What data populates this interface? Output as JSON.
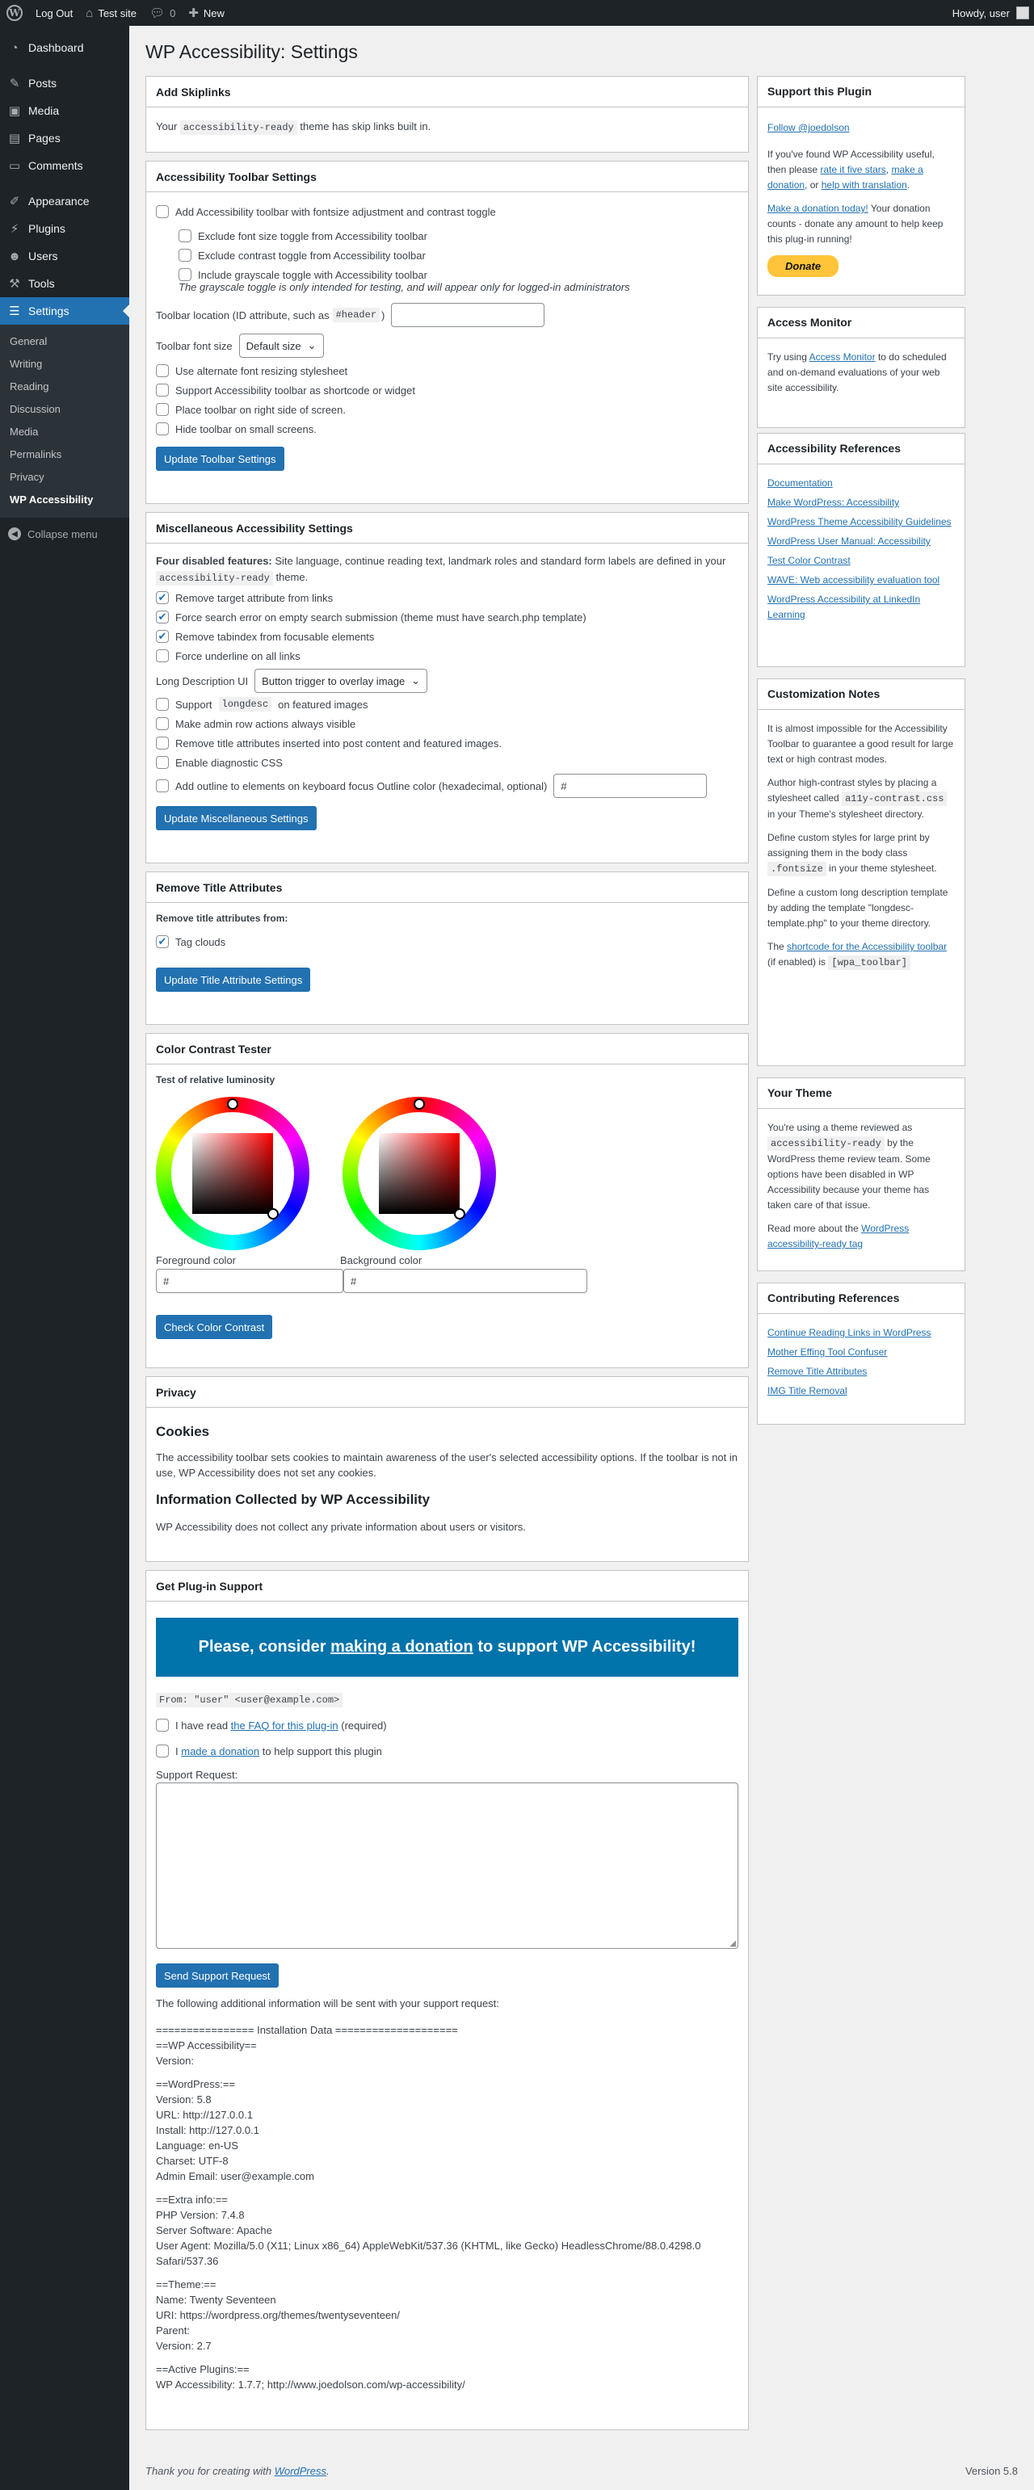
{
  "adminbar": {
    "logout": "Log Out",
    "site": "Test site",
    "comments_count": "0",
    "new": "New",
    "howdy": "Howdy, user"
  },
  "sidebar": {
    "items": [
      {
        "label": "Dashboard",
        "icon": "dashboard-icon"
      },
      {
        "label": "Posts",
        "icon": "pin-icon"
      },
      {
        "label": "Media",
        "icon": "media-icon"
      },
      {
        "label": "Pages",
        "icon": "page-icon"
      },
      {
        "label": "Comments",
        "icon": "comment-icon"
      },
      {
        "label": "Appearance",
        "icon": "brush-icon"
      },
      {
        "label": "Plugins",
        "icon": "plugin-icon"
      },
      {
        "label": "Users",
        "icon": "user-icon"
      },
      {
        "label": "Tools",
        "icon": "wrench-icon"
      },
      {
        "label": "Settings",
        "icon": "settings-icon"
      }
    ],
    "submenu": [
      "General",
      "Writing",
      "Reading",
      "Discussion",
      "Media",
      "Permalinks",
      "Privacy",
      "WP Accessibility"
    ],
    "collapse": "Collapse menu"
  },
  "page": {
    "title": "WP Accessibility: Settings"
  },
  "skiplinks": {
    "title": "Add Skiplinks",
    "text_pre": "Your",
    "code": "accessibility-ready",
    "text_post": "theme has skip links built in."
  },
  "toolbar": {
    "title": "Accessibility Toolbar Settings",
    "add": "Add Accessibility toolbar with fontsize adjustment and contrast toggle",
    "ex_font": "Exclude font size toggle from Accessibility toolbar",
    "ex_contrast": "Exclude contrast toggle from Accessibility toolbar",
    "grayscale": "Include grayscale toggle with Accessibility toolbar",
    "grayscale_note": "The grayscale toggle is only intended for testing, and will appear only for logged-in administrators",
    "location_pre": "Toolbar location (ID attribute, such as",
    "location_code": "#header",
    "location_post": ")",
    "font_label": "Toolbar font size",
    "font_value": "Default size",
    "alt_font": "Use alternate font resizing stylesheet",
    "shortcode": "Support Accessibility toolbar as shortcode or widget",
    "right": "Place toolbar on right side of screen.",
    "hide": "Hide toolbar on small screens.",
    "button": "Update Toolbar Settings"
  },
  "misc": {
    "title": "Miscellaneous Accessibility Settings",
    "disabled_bold": "Four disabled features:",
    "disabled_text": "Site language, continue reading text, landmark roles and standard form labels are defined in your",
    "disabled_code": "accessibility-ready",
    "disabled_post": "theme.",
    "target": "Remove target attribute from links",
    "search": "Force search error on empty search submission (theme must have search.php template)",
    "tabindex": "Remove tabindex from focusable elements",
    "underline": "Force underline on all links",
    "longdesc_label": "Long Description UI",
    "longdesc_value": "Button trigger to overlay image",
    "support_pre": "Support",
    "support_code": "longdesc",
    "support_post": "on featured images",
    "admin_rows": "Make admin row actions always visible",
    "title_attr": "Remove title attributes inserted into post content and featured images.",
    "diagnostic": "Enable diagnostic CSS",
    "outline": "Add outline to elements on keyboard focus Outline color (hexadecimal, optional)",
    "outline_value": "#",
    "button": "Update Miscellaneous Settings"
  },
  "titleattr": {
    "title": "Remove Title Attributes",
    "from": "Remove title attributes from:",
    "tag": "Tag clouds",
    "button": "Update Title Attribute Settings"
  },
  "contrast": {
    "title": "Color Contrast Tester",
    "sub": "Test of relative luminosity",
    "fg_label": "Foreground color",
    "bg_label": "Background color",
    "fg_value": "#",
    "bg_value": "#",
    "button": "Check Color Contrast"
  },
  "privacy": {
    "title": "Privacy",
    "cookies_h": "Cookies",
    "cookies_text": "The accessibility toolbar sets cookies to maintain awareness of the user's selected accessibility options. If the toolbar is not in use, WP Accessibility does not set any cookies.",
    "info_h": "Information Collected by WP Accessibility",
    "info_text": "WP Accessibility does not collect any private information about users or visitors."
  },
  "support": {
    "title": "Get Plug-in Support",
    "banner_pre": "Please, consider",
    "banner_link": "making a donation",
    "banner_post": "to support WP Accessibility!",
    "from": "From: \"user\" <user@example.com>",
    "faq_pre": "I have read",
    "faq_link": "the FAQ for this plug-in",
    "faq_post": "(required)",
    "don_pre": "I",
    "don_link": "made a donation",
    "don_post": "to help support this plugin",
    "request_label": "Support Request:",
    "button": "Send Support Request",
    "following": "The following additional information will be sent with your support request:",
    "install": "================ Installation Data ====================\n==WP Accessibility==\nVersion:",
    "wp": "==WordPress:==\nVersion: 5.8\nURL: http://127.0.0.1\nInstall: http://127.0.0.1\nLanguage: en-US\nCharset: UTF-8\nAdmin Email: user@example.com",
    "extra": "==Extra info:==\nPHP Version: 7.4.8\nServer Software: Apache\nUser Agent: Mozilla/5.0 (X11; Linux x86_64) AppleWebKit/537.36 (KHTML, like Gecko) HeadlessChrome/88.0.4298.0 Safari/537.36",
    "theme": "==Theme:==\nName: Twenty Seventeen\nURI: https://wordpress.org/themes/twentyseventeen/\nParent:\nVersion: 2.7",
    "plugins": "==Active Plugins:==\nWP Accessibility: 1.7.7; http://www.joedolson.com/wp-accessibility/"
  },
  "side": {
    "support": {
      "title": "Support this Plugin",
      "follow": "Follow @joedolson",
      "p1_pre": "If you've found WP Accessibility useful, then please",
      "p1_l1": "rate it five stars",
      "p1_c1": ",",
      "p1_l2": "make a donation",
      "p1_c2": ", or",
      "p1_l3": "help with translation",
      "p1_end": ".",
      "p2_link": "Make a donation today!",
      "p2_text": "Your donation counts - donate any amount to help keep this plug-in running!",
      "donate": "Donate"
    },
    "monitor": {
      "title": "Access Monitor",
      "pre": "Try using",
      "link": "Access Monitor",
      "post": "to do scheduled and on-demand evaluations of your web site accessibility."
    },
    "refs": {
      "title": "Accessibility References",
      "links": [
        "Documentation",
        "Make WordPress: Accessibility",
        "WordPress Theme Accessibility Guidelines",
        "WordPress User Manual: Accessibility",
        "Test Color Contrast",
        "WAVE: Web accessibility evaluation tool",
        "WordPress Accessibility at LinkedIn Learning"
      ]
    },
    "notes": {
      "title": "Customization Notes",
      "p1": "It is almost impossible for the Accessibility Toolbar to guarantee a good result for large text or high contrast modes.",
      "p2_pre": "Author high-contrast styles by placing a stylesheet called",
      "p2_code": "a11y-contrast.css",
      "p2_post": "in your Theme's stylesheet directory.",
      "p3_pre": "Define custom styles for large print by assigning them in the body class",
      "p3_code": ".fontsize",
      "p3_post": "in your theme stylesheet.",
      "p4": "Define a custom long description template by adding the template \"longdesc-template.php\" to your theme directory.",
      "p5_pre": "The",
      "p5_link": "shortcode for the Accessibility toolbar",
      "p5_post": "(if enabled) is",
      "p5_code": "[wpa_toolbar]"
    },
    "theme": {
      "title": "Your Theme",
      "p1_pre": "You're using a theme reviewed as",
      "p1_code": "accessibility-ready",
      "p1_post": "by the WordPress theme review team. Some options have been disabled in WP Accessibility because your theme has taken care of that issue.",
      "p2_pre": "Read more about the",
      "p2_link": "WordPress accessibility-ready tag"
    },
    "contrib": {
      "title": "Contributing References",
      "links": [
        "Continue Reading Links in WordPress",
        "Mother Effing Tool Confuser",
        "Remove Title Attributes",
        "IMG Title Removal"
      ]
    }
  },
  "footer": {
    "thanks_pre": "Thank you for creating with",
    "thanks_link": "WordPress",
    "thanks_end": ".",
    "version": "Version 5.8"
  },
  "colors": {
    "accent": "#2271b1",
    "adminbar": "#1d2327",
    "banner": "#0073aa"
  }
}
